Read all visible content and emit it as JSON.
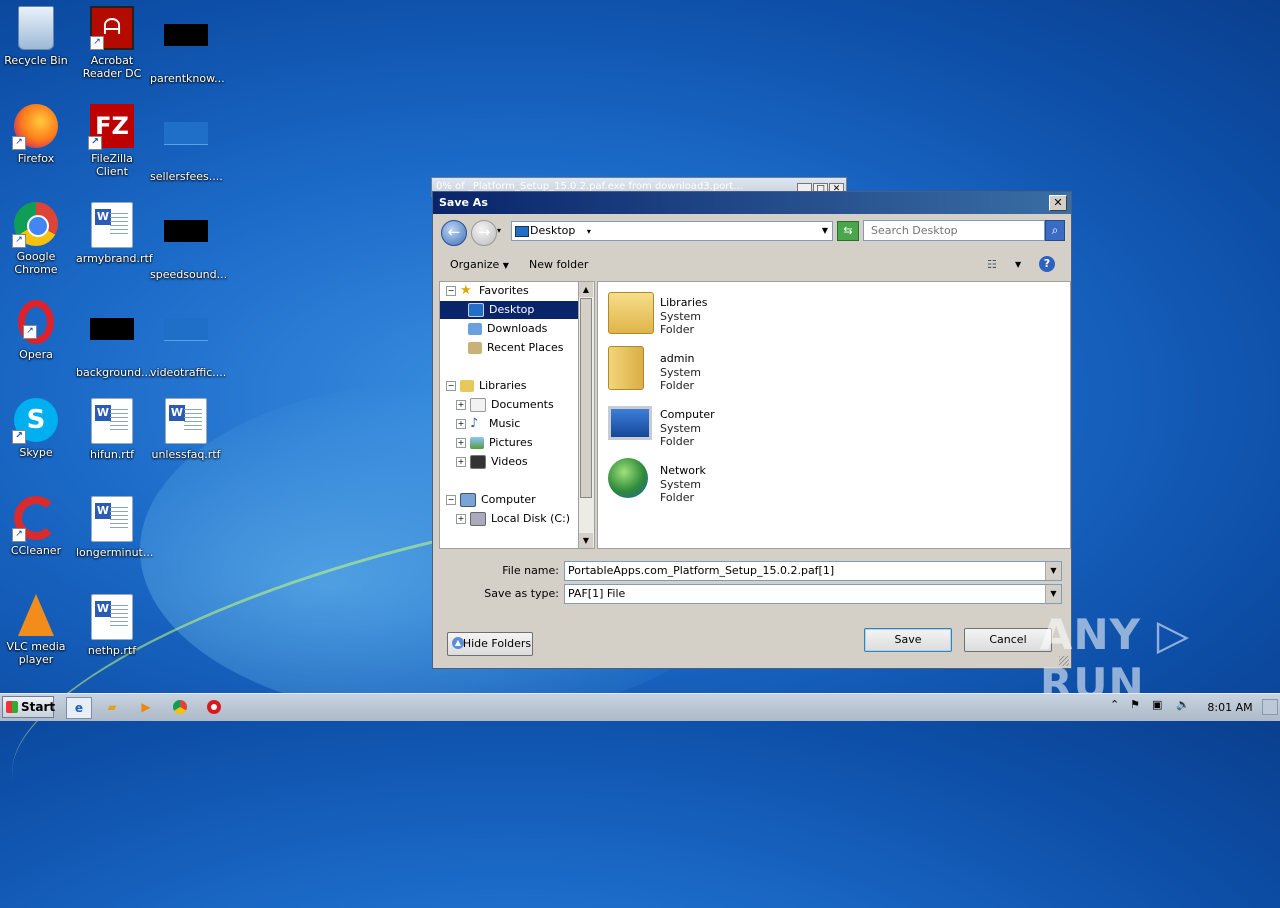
{
  "desktop": {
    "icons": [
      {
        "label": "Recycle Bin"
      },
      {
        "label": "Acrobat Reader DC"
      },
      {
        "label": "parentknow..."
      },
      {
        "label": "Firefox"
      },
      {
        "label": "FileZilla Client"
      },
      {
        "label": "sellersfees...."
      },
      {
        "label": "Google Chrome"
      },
      {
        "label": "armybrand.rtf"
      },
      {
        "label": "speedsound..."
      },
      {
        "label": "Opera"
      },
      {
        "label": "background..."
      },
      {
        "label": "videotraffic...."
      },
      {
        "label": "Skype"
      },
      {
        "label": "hifun.rtf"
      },
      {
        "label": "unlessfaq.rtf"
      },
      {
        "label": "CCleaner"
      },
      {
        "label": "longerminut..."
      },
      {
        "label": "VLC media player"
      },
      {
        "label": "nethp.rtf"
      }
    ]
  },
  "background_window": {
    "title": "0% of _Platform_Setup_15.0.2.paf.exe from download3.port..."
  },
  "dialog": {
    "title": "Save As",
    "close_label": "✕",
    "path": "Desktop",
    "search_placeholder": "Search Desktop",
    "organize_label": "Organize",
    "new_folder_label": "New folder",
    "tree": {
      "favorites": "Favorites",
      "desktop": "Desktop",
      "downloads": "Downloads",
      "recent_places": "Recent Places",
      "libraries": "Libraries",
      "documents": "Documents",
      "music": "Music",
      "pictures": "Pictures",
      "videos": "Videos",
      "computer": "Computer",
      "local_disk": "Local Disk (C:)"
    },
    "items": [
      {
        "name": "Libraries",
        "type": "System Folder"
      },
      {
        "name": "admin",
        "type": "System Folder"
      },
      {
        "name": "Computer",
        "type": "System Folder"
      },
      {
        "name": "Network",
        "type": "System Folder"
      }
    ],
    "file_name_label": "File name:",
    "file_name_value": "PortableApps.com_Platform_Setup_15.0.2.paf[1]",
    "save_type_label": "Save as type:",
    "save_type_value": "PAF[1] File",
    "hide_folders_label": "Hide Folders",
    "save_label": "Save",
    "cancel_label": "Cancel"
  },
  "taskbar": {
    "start_label": "Start",
    "clock": "8:01 AM"
  },
  "watermark": "ANY ▷ RUN"
}
